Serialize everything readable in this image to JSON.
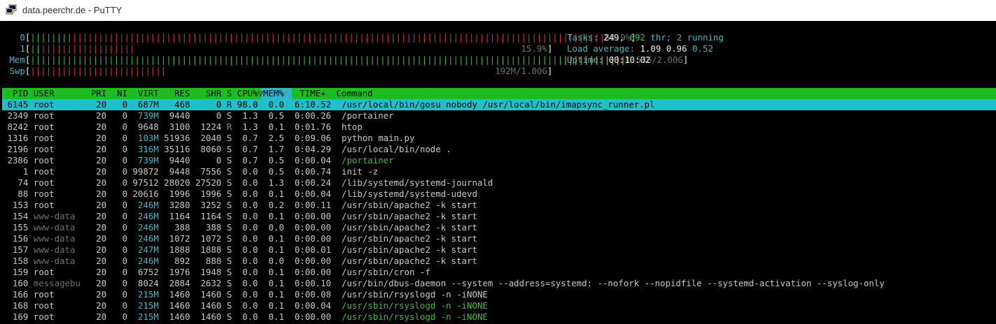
{
  "window": {
    "title": "data.peerchr.de - PuTTY",
    "icon": "putty-icon"
  },
  "meters": [
    {
      "label": "0",
      "green": "||||||||",
      "red": "||||||||||||||||||||||||||||||||||||||||||||||||||||||||||||||||||||||||||||||||||||||||||||||||||||||",
      "yellow": "",
      "value": "84.9%",
      "percent": 84.9
    },
    {
      "label": "1",
      "green": "||",
      "red": "||||||||||||||||||",
      "yellow": "",
      "value": "15.9%",
      "percent": 15.9
    },
    {
      "label": "Mem",
      "green": "||||||||||||||||||||||||||||||||||||||||||||||||||||||||||||||||||||||||||||||||||||||||||||||||||||||",
      "red": "",
      "yellow": "||||||||||||",
      "value": "1.53G/2.00G",
      "percent": 76.5
    },
    {
      "label": "Swp",
      "green": "",
      "red": "||||||||||||||||||||||||||",
      "yellow": "",
      "value": "192M/1.00G",
      "percent": 18.8
    }
  ],
  "stats": {
    "tasks_label": "Tasks:",
    "tasks": "249,",
    "thr": "692",
    "thr_label": "thr;",
    "running": "2",
    "running_label": "running",
    "load_label": "Load average:",
    "load1": "1.09",
    "load5": "0.96",
    "load15": "0.52",
    "uptime_label": "Uptime:",
    "uptime": "00:10:02"
  },
  "table": {
    "header": "  PID USER       PRI  NI  VIRT   RES   SHR S CPU%▽MEM%   TIME+  Command",
    "rows": [
      {
        "pid": "6145",
        "user": "root",
        "pri": "20",
        "ni": "0",
        "virt": "687M",
        "res": "468",
        "shr": "0",
        "s": "R",
        "cpu": "98.0",
        "mem": "0.0",
        "time": "6:10.52",
        "cmd": "/usr/local/bin/gosu nobody /usr/local/bin/imapsync_runner.pl",
        "selected": true
      },
      {
        "pid": "2349",
        "user": "root",
        "pri": "20",
        "ni": "0",
        "virt": "739M",
        "res": "9440",
        "shr": "0",
        "s": "S",
        "cpu": "1.3",
        "mem": "0.5",
        "time": "0:00.26",
        "cmd": "/portainer"
      },
      {
        "pid": "8242",
        "user": "root",
        "pri": "20",
        "ni": "0",
        "virt": "9648",
        "res": "3100",
        "shr": "1224",
        "s": "R",
        "cpu": "1.3",
        "mem": "0.1",
        "time": "0:01.76",
        "cmd": "htop"
      },
      {
        "pid": "1316",
        "user": "root",
        "pri": "20",
        "ni": "0",
        "virt": "103M",
        "res": "51936",
        "shr": "2040",
        "s": "S",
        "cpu": "0.7",
        "mem": "2.5",
        "time": "0:09.06",
        "cmd": "python main.py"
      },
      {
        "pid": "2196",
        "user": "root",
        "pri": "20",
        "ni": "0",
        "virt": "316M",
        "res": "35116",
        "shr": "8060",
        "s": "S",
        "cpu": "0.7",
        "mem": "1.7",
        "time": "0:04.29",
        "cmd": "/usr/local/bin/node ."
      },
      {
        "pid": "2386",
        "user": "root",
        "pri": "20",
        "ni": "0",
        "virt": "739M",
        "res": "9440",
        "shr": "0",
        "s": "S",
        "cpu": "0.7",
        "mem": "0.5",
        "time": "0:00.04",
        "cmd": "/portainer",
        "thread": true
      },
      {
        "pid": "1",
        "user": "root",
        "pri": "20",
        "ni": "0",
        "virt": "99872",
        "res": "9448",
        "shr": "7556",
        "s": "S",
        "cpu": "0.0",
        "mem": "0.5",
        "time": "0:00.74",
        "cmd": "init -z"
      },
      {
        "pid": "74",
        "user": "root",
        "pri": "20",
        "ni": "0",
        "virt": "97512",
        "res": "28020",
        "shr": "27520",
        "s": "S",
        "cpu": "0.0",
        "mem": "1.3",
        "time": "0:00.24",
        "cmd": "/lib/systemd/systemd-journald"
      },
      {
        "pid": "88",
        "user": "root",
        "pri": "20",
        "ni": "0",
        "virt": "20616",
        "res": "1996",
        "shr": "1996",
        "s": "S",
        "cpu": "0.0",
        "mem": "0.1",
        "time": "0:00.04",
        "cmd": "/lib/systemd/systemd-udevd"
      },
      {
        "pid": "153",
        "user": "root",
        "pri": "20",
        "ni": "0",
        "virt": "246M",
        "res": "3280",
        "shr": "3252",
        "s": "S",
        "cpu": "0.0",
        "mem": "0.2",
        "time": "0:00.11",
        "cmd": "/usr/sbin/apache2 -k start"
      },
      {
        "pid": "154",
        "user": "www-data",
        "pri": "20",
        "ni": "0",
        "virt": "246M",
        "res": "1164",
        "shr": "1164",
        "s": "S",
        "cpu": "0.0",
        "mem": "0.1",
        "time": "0:00.00",
        "cmd": "/usr/sbin/apache2 -k start"
      },
      {
        "pid": "155",
        "user": "www-data",
        "pri": "20",
        "ni": "0",
        "virt": "246M",
        "res": "388",
        "shr": "388",
        "s": "S",
        "cpu": "0.0",
        "mem": "0.0",
        "time": "0:00.00",
        "cmd": "/usr/sbin/apache2 -k start"
      },
      {
        "pid": "156",
        "user": "www-data",
        "pri": "20",
        "ni": "0",
        "virt": "246M",
        "res": "1072",
        "shr": "1072",
        "s": "S",
        "cpu": "0.0",
        "mem": "0.1",
        "time": "0:00.00",
        "cmd": "/usr/sbin/apache2 -k start"
      },
      {
        "pid": "157",
        "user": "www-data",
        "pri": "20",
        "ni": "0",
        "virt": "247M",
        "res": "1888",
        "shr": "1888",
        "s": "S",
        "cpu": "0.0",
        "mem": "0.1",
        "time": "0:00.01",
        "cmd": "/usr/sbin/apache2 -k start"
      },
      {
        "pid": "158",
        "user": "www-data",
        "pri": "20",
        "ni": "0",
        "virt": "246M",
        "res": "892",
        "shr": "888",
        "s": "S",
        "cpu": "0.0",
        "mem": "0.0",
        "time": "0:00.00",
        "cmd": "/usr/sbin/apache2 -k start"
      },
      {
        "pid": "159",
        "user": "root",
        "pri": "20",
        "ni": "0",
        "virt": "6752",
        "res": "1976",
        "shr": "1948",
        "s": "S",
        "cpu": "0.0",
        "mem": "0.1",
        "time": "0:00.00",
        "cmd": "/usr/sbin/cron -f"
      },
      {
        "pid": "160",
        "user": "messagebu",
        "pri": "20",
        "ni": "0",
        "virt": "8024",
        "res": "2884",
        "shr": "2632",
        "s": "S",
        "cpu": "0.0",
        "mem": "0.1",
        "time": "0:00.10",
        "cmd": "/usr/bin/dbus-daemon --system --address=systemd: --nofork --nopidfile --systemd-activation --syslog-only"
      },
      {
        "pid": "166",
        "user": "root",
        "pri": "20",
        "ni": "0",
        "virt": "215M",
        "res": "1460",
        "shr": "1460",
        "s": "S",
        "cpu": "0.0",
        "mem": "0.1",
        "time": "0:00.08",
        "cmd": "/usr/sbin/rsyslogd -n -iNONE"
      },
      {
        "pid": "168",
        "user": "root",
        "pri": "20",
        "ni": "0",
        "virt": "215M",
        "res": "1460",
        "shr": "1460",
        "s": "S",
        "cpu": "0.0",
        "mem": "0.1",
        "time": "0:00.04",
        "cmd": "/usr/sbin/rsyslogd -n -iNONE",
        "thread": true
      },
      {
        "pid": "169",
        "user": "root",
        "pri": "20",
        "ni": "0",
        "virt": "215M",
        "res": "1460",
        "shr": "1460",
        "s": "S",
        "cpu": "0.0",
        "mem": "0.1",
        "time": "0:00.00",
        "cmd": "/usr/sbin/rsyslogd -n -iNONE",
        "thread": true
      }
    ]
  }
}
